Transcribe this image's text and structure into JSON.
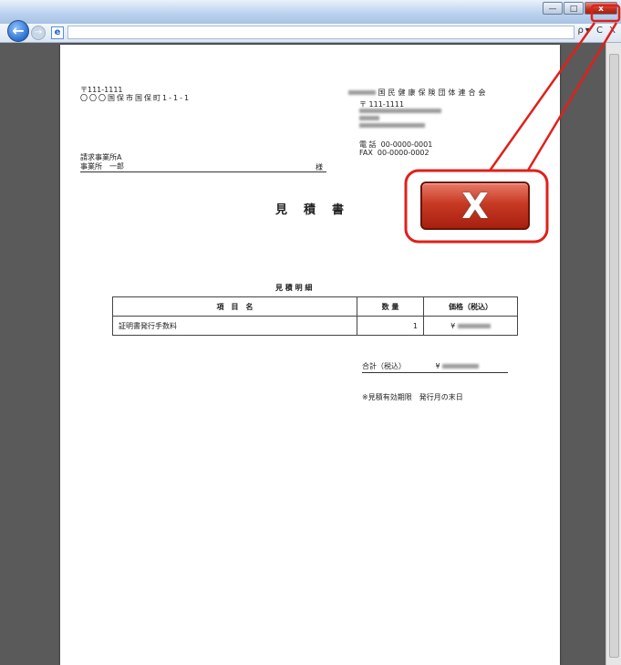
{
  "window": {
    "minimize_label": "—",
    "maximize_label": "□",
    "close_label": "x"
  },
  "nav": {
    "back_glyph": "←",
    "forward_glyph": "→",
    "favicon_glyph": "e",
    "toolbar_glyphs": "ρ▾ C X"
  },
  "document": {
    "sender_postal": "〒111-1111",
    "sender_address": "〇〇〇国保市国保町1-1-1",
    "issuer_name": "国民健康保険団体連合会",
    "issuer_postal": "〒 111-1111",
    "tel_label": "電 話",
    "tel_value": "00-0000-0001",
    "fax_label": "FAX",
    "fax_value": "00-0000-0002",
    "recipient_company": "請求事業所A",
    "recipient_person": "事業所　一郎",
    "honorific": "様",
    "title": "見積書",
    "detail_heading": "見 積 明 細",
    "table": {
      "headers": [
        "項　目　名",
        "数 量",
        "価格（税込）"
      ],
      "rows": [
        {
          "item": "証明書発行手数料",
          "qty": "1",
          "price": "¥"
        }
      ]
    },
    "total_label": "合計（税込）",
    "total_currency": "¥",
    "validity_note": "※見積有効期限　発行月の末日"
  },
  "callout": {
    "button_glyph": "X",
    "accent_color": "#e0201a"
  }
}
